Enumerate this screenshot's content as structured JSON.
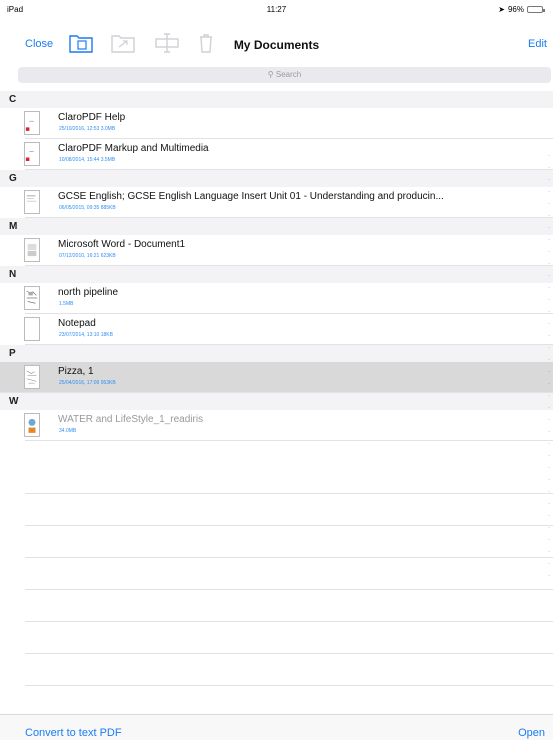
{
  "status": {
    "carrier": "iPad",
    "time": "11:27",
    "battery": "96%"
  },
  "nav": {
    "close": "Close",
    "title": "My Documents",
    "edit": "Edit"
  },
  "search": {
    "placeholder": "Search"
  },
  "sections": [
    {
      "letter": "C",
      "items": [
        {
          "name": "ClaroPDF Help",
          "meta": "25/10/2016, 12:53 3.0MB"
        },
        {
          "name": "ClaroPDF Markup and Multimedia",
          "meta": "10/08/2014, 15:44 3.5MB"
        }
      ]
    },
    {
      "letter": "G",
      "items": [
        {
          "name": "GCSE English; GCSE English Language Insert Unit 01 - Understanding and producin...",
          "meta": "06/05/2015, 09:35 885KB"
        }
      ]
    },
    {
      "letter": "M",
      "items": [
        {
          "name": "Microsoft Word - Document1",
          "meta": "07/12/2010, 16:21 623KB"
        }
      ]
    },
    {
      "letter": "N",
      "items": [
        {
          "name": "north pipeline",
          "meta": "1.5MB"
        },
        {
          "name": "Notepad",
          "meta": "23/07/2014, 13:10 18KB"
        }
      ]
    },
    {
      "letter": "P",
      "items": [
        {
          "name": "Pizza, 1",
          "meta": "25/04/2016, 17:09 953KB"
        }
      ]
    },
    {
      "letter": "W",
      "items": [
        {
          "name": "WATER and LifeStyle_1_readiris",
          "meta": "34.0MB"
        }
      ]
    }
  ],
  "bottom": {
    "convert": "Convert to text PDF",
    "open": "Open"
  },
  "colors": {
    "accent": "#1a7cf2",
    "meta": "#2f8df5",
    "selected": "#d9d9d9"
  }
}
